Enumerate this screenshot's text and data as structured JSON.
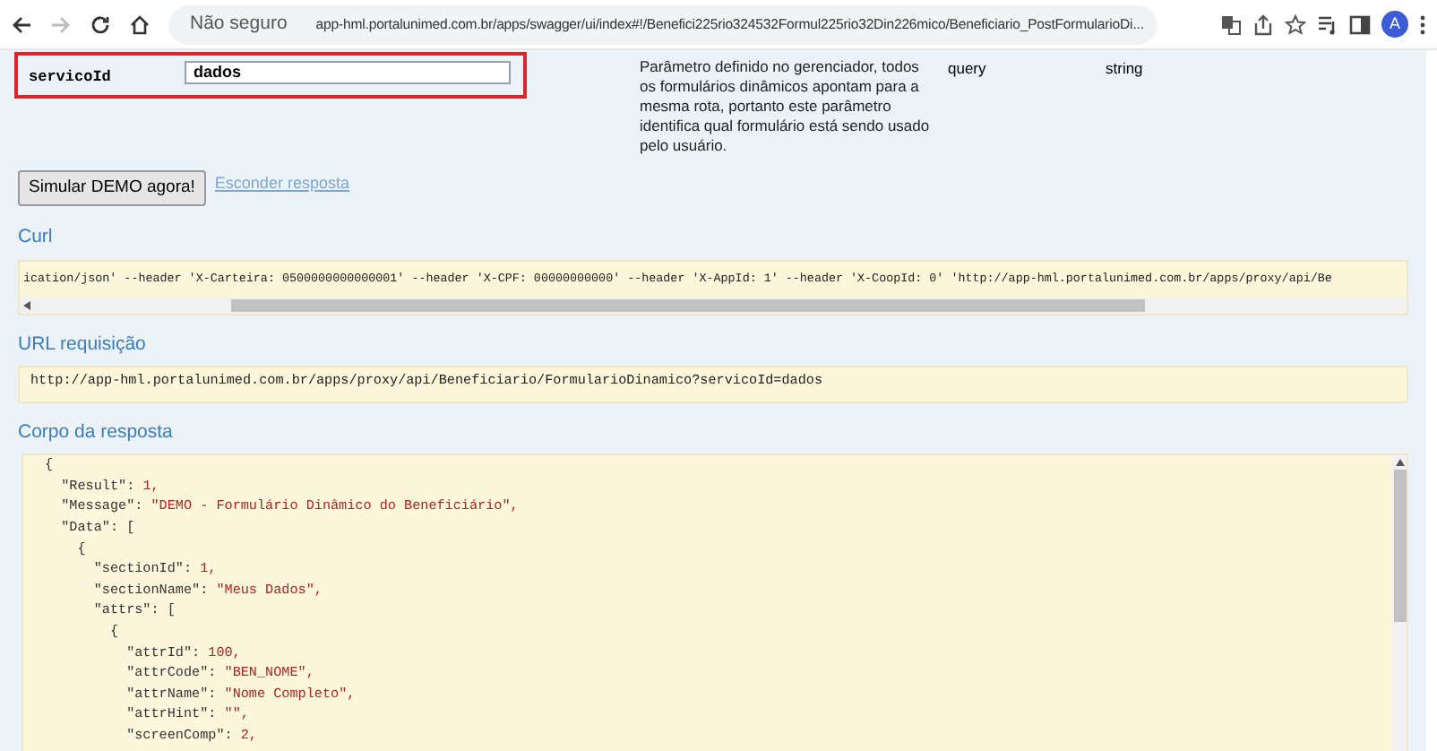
{
  "browser": {
    "security_label": "Não seguro",
    "url": "app-hml.portalunimed.com.br/apps/swagger/ui/index#!/Benefici225rio324532Formul225rio32Din226mico/Beneficiario_PostFormularioDi...",
    "avatar": "A"
  },
  "parameter": {
    "name": "servicoId",
    "value": "dados",
    "description": "Parâmetro definido no gerenciador, todos os formulários dinâmicos apontam para a mesma rota, portanto este parâmetro identifica qual formulário está sendo usado pelo usuário.",
    "type": "query",
    "data_type": "string"
  },
  "try_button": "Simular DEMO agora!",
  "hide_link": "Esconder resposta",
  "curl": {
    "title": "Curl",
    "command": "ication/json' --header 'X-Carteira: 0500000000000001' --header 'X-CPF: 00000000000' --header 'X-AppId: 1' --header 'X-CoopId: 0' 'http://app-hml.portalunimed.com.br/apps/proxy/api/Be"
  },
  "request_url": {
    "title": "URL requisição",
    "url": "http://app-hml.portalunimed.com.br/apps/proxy/api/Beneficiario/FormularioDinamico?servicoId=dados"
  },
  "response_body": {
    "title": "Corpo da resposta",
    "lines": [
      "{",
      "  \"Result\": 1,",
      "  \"Message\": \"DEMO - Formulário Dinâmico do Beneficiário\",",
      "  \"Data\": [",
      "    {",
      "      \"sectionId\": 1,",
      "      \"sectionName\": \"Meus Dados\",",
      "      \"attrs\": [",
      "        {",
      "          \"attrId\": 100,",
      "          \"attrCode\": \"BEN_NOME\",",
      "          \"attrName\": \"Nome Completo\",",
      "          \"attrHint\": \"\",",
      "          \"screenComp\": 2,"
    ]
  }
}
